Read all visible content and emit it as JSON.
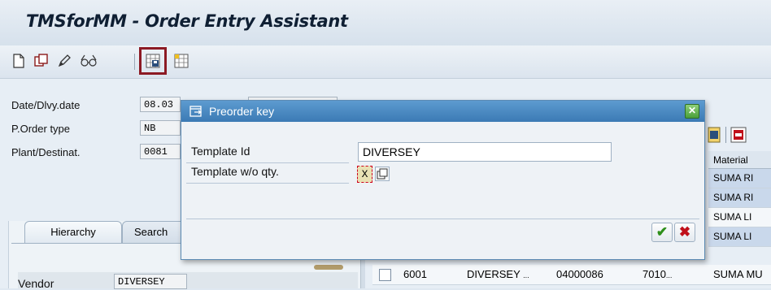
{
  "app": {
    "title": "TMSforMM - Order Entry Assistant"
  },
  "toolbar": {
    "icons": [
      "new-document-icon",
      "copy-icon",
      "edit-pencil-icon",
      "display-glasses-icon",
      "template-save-icon",
      "template-grid-icon"
    ]
  },
  "header_fields": [
    {
      "label": "Date/Dlvy.date",
      "value": "08.03"
    },
    {
      "label": "P.Order type",
      "value": "NB"
    },
    {
      "label": "Plant/Destinat.",
      "value": "0081"
    }
  ],
  "tabs": [
    {
      "label": "Hierarchy"
    },
    {
      "label": "Search"
    }
  ],
  "vendor": {
    "label": "Vendor",
    "value": "DIVERSEY"
  },
  "grid": {
    "header": "Material",
    "cells": [
      "SUMA RI",
      "SUMA RI",
      "SUMA LI",
      "SUMA LI"
    ],
    "row5": {
      "col1": "6001",
      "col2": "DIVERSEY",
      "col3": "04000086",
      "col4": "7010",
      "col5": "SUMA MU"
    },
    "ellipsis": "..."
  },
  "dialog": {
    "title": "Preorder key",
    "close_label": "✕",
    "fields": [
      {
        "label": "Template Id",
        "value": "DIVERSEY"
      },
      {
        "label": "Template w/o qty.",
        "value": "X"
      }
    ],
    "ok_label": "✔",
    "cancel_label": "✖"
  },
  "colors": {
    "accent": "#3b7ab4",
    "highlight": "#8c1a24"
  }
}
